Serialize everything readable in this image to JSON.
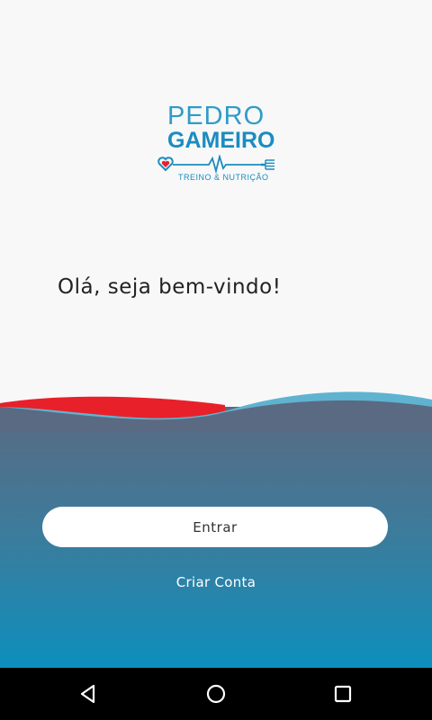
{
  "logo": {
    "line1": "PEDRO",
    "line2": "GAMEIRO",
    "tagline": "TREINO & NUTRIÇÃO"
  },
  "greeting": "Olá, seja bem-vindo!",
  "actions": {
    "enter_label": "Entrar",
    "create_account_label": "Criar Conta"
  },
  "colors": {
    "brand_blue": "#1a8cc0",
    "wave_red": "#e8202a",
    "wave_blue": "#5fb3d0",
    "gradient_top": "#5a6a82",
    "gradient_bottom": "#0d8fbd"
  },
  "navbar": {
    "back_icon": "back-triangle-icon",
    "home_icon": "home-circle-icon",
    "recents_icon": "recents-square-icon"
  }
}
